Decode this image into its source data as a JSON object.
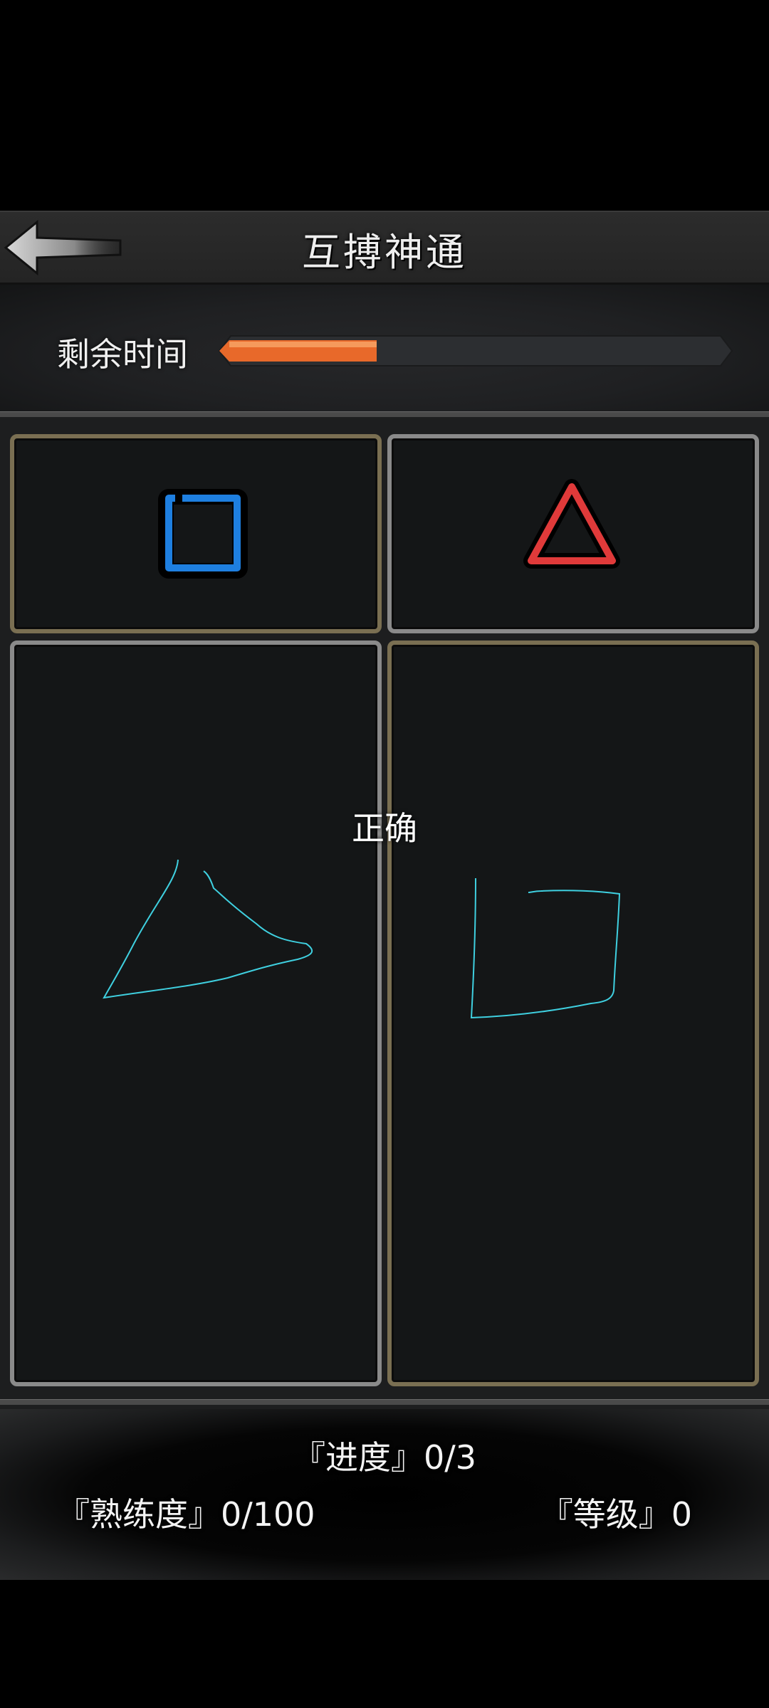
{
  "header": {
    "title": "互搏神通"
  },
  "timer": {
    "label": "剩余时间",
    "remaining_fraction": 0.3,
    "fill_color": "#e8692a"
  },
  "targets": {
    "left_shape": "square",
    "left_color": "#1e7fe0",
    "right_shape": "triangle",
    "right_color": "#e03a3a"
  },
  "drawing": {
    "stroke_color": "#3fd0e0",
    "left_drawn_shape": "triangle",
    "right_drawn_shape": "square"
  },
  "feedback": {
    "text": "正确"
  },
  "stats": {
    "progress": "『进度』0/3",
    "proficiency": "『熟练度』0/100",
    "level": "『等级』0"
  },
  "icons": {
    "back": "back-arrow-icon"
  }
}
